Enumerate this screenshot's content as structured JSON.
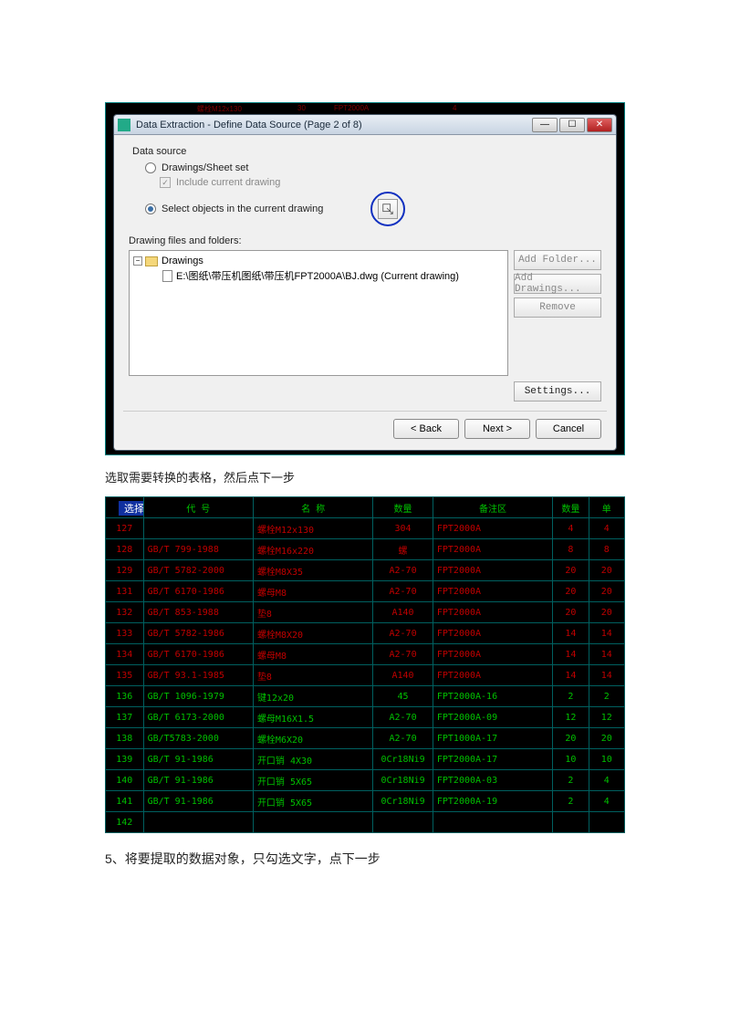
{
  "dialog": {
    "title": "Data Extraction - Define Data Source (Page 2 of 8)",
    "section_data_source": "Data source",
    "radio_drawings": "Drawings/Sheet set",
    "check_include": "Include current drawing",
    "radio_select_objects": "Select objects in the current drawing",
    "files_label": "Drawing files and folders:",
    "tree_root": "Drawings",
    "tree_file": "E:\\图纸\\带压机图纸\\带压机FPT2000A\\BJ.dwg (Current drawing)",
    "btn_add_folder": "Add Folder...",
    "btn_add_drawings": "Add Drawings...",
    "btn_remove": "Remove",
    "btn_settings": "Settings...",
    "btn_back": "< Back",
    "btn_next": "Next >",
    "btn_cancel": "Cancel"
  },
  "caption1": "选取需要转换的表格，然后点下一步",
  "cad_prompt": "选择对象:",
  "cad_cols": [
    "代 号",
    "名 称",
    "数量",
    "备注区",
    "数量",
    "单"
  ],
  "cad_rows": [
    {
      "c": "red",
      "n": "127",
      "gb": "",
      "name": "螺栓M12x130",
      "q": "304",
      "rem": "FPT2000A",
      "a": "4",
      "b": "4"
    },
    {
      "c": "red",
      "n": "128",
      "gb": "GB/T 799-1988",
      "name": "螺栓M16x220",
      "q": "螺",
      "rem": "FPT2000A",
      "a": "8",
      "b": "8"
    },
    {
      "c": "red",
      "n": "129",
      "gb": "GB/T 5782-2000",
      "name": "螺栓M8X35",
      "q": "A2-70",
      "rem": "FPT2000A",
      "a": "20",
      "b": "20"
    },
    {
      "c": "red",
      "n": "131",
      "gb": "GB/T 6170-1986",
      "name": "螺母M8",
      "q": "A2-70",
      "rem": "FPT2000A",
      "a": "20",
      "b": "20"
    },
    {
      "c": "red",
      "n": "132",
      "gb": "GB/T 853-1988",
      "name": "垫8",
      "q": "A140",
      "rem": "FPT2000A",
      "a": "20",
      "b": "20"
    },
    {
      "c": "red",
      "n": "133",
      "gb": "GB/T 5782-1986",
      "name": "螺栓M8X20",
      "q": "A2-70",
      "rem": "FPT2000A",
      "a": "14",
      "b": "14"
    },
    {
      "c": "red",
      "n": "134",
      "gb": "GB/T 6170-1986",
      "name": "螺母M8",
      "q": "A2-70",
      "rem": "FPT2000A",
      "a": "14",
      "b": "14"
    },
    {
      "c": "red",
      "n": "135",
      "gb": "GB/T 93.1-1985",
      "name": "垫8",
      "q": "A140",
      "rem": "FPT2000A",
      "a": "14",
      "b": "14"
    },
    {
      "c": "green",
      "n": "136",
      "gb": "GB/T 1096-1979",
      "name": "键12x20",
      "q": "45",
      "rem": "FPT2000A-16",
      "a": "2",
      "b": "2"
    },
    {
      "c": "green",
      "n": "137",
      "gb": "GB/T 6173-2000",
      "name": "螺母M16X1.5",
      "q": "A2-70",
      "rem": "FPT2000A-09",
      "a": "12",
      "b": "12"
    },
    {
      "c": "green",
      "n": "138",
      "gb": "GB/T5783-2000",
      "name": "螺栓M6X20",
      "q": "A2-70",
      "rem": "FPT1000A-17",
      "a": "20",
      "b": "20"
    },
    {
      "c": "green",
      "n": "139",
      "gb": "GB/T 91-1986",
      "name": "开口销 4X30",
      "q": "0Cr18Ni9",
      "rem": "FPT2000A-17",
      "a": "10",
      "b": "10"
    },
    {
      "c": "green",
      "n": "140",
      "gb": "GB/T 91-1986",
      "name": "开口销 5X65",
      "q": "0Cr18Ni9",
      "rem": "FPT2000A-03",
      "a": "2",
      "b": "4"
    },
    {
      "c": "green",
      "n": "141",
      "gb": "GB/T 91-1986",
      "name": "开口销 5X65",
      "q": "0Cr18Ni9",
      "rem": "FPT2000A-19",
      "a": "2",
      "b": "4"
    },
    {
      "c": "green",
      "n": "142",
      "gb": "",
      "name": "",
      "q": "",
      "rem": "",
      "a": "",
      "b": ""
    }
  ],
  "step5": "5、将要提取的数据对象，只勾选文字，点下一步"
}
